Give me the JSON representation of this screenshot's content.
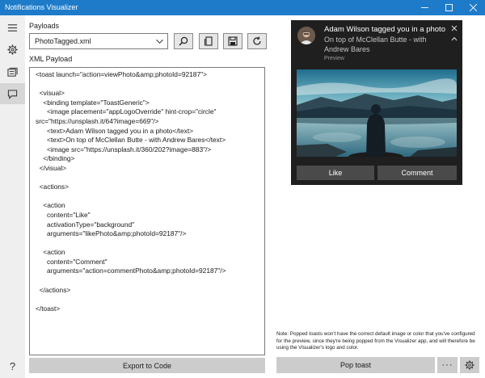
{
  "window": {
    "title": "Notifications Visualizer"
  },
  "sidebar": {
    "items": [
      {
        "name": "hamburger-menu",
        "icon": "hamburger-icon"
      },
      {
        "name": "settings",
        "icon": "gear-icon"
      },
      {
        "name": "gallery",
        "icon": "gallery-icon"
      },
      {
        "name": "notifications",
        "icon": "chat-bubble-icon",
        "active": true
      },
      {
        "name": "help",
        "icon": "question-icon",
        "help_glyph": "?"
      }
    ]
  },
  "payloads": {
    "label": "Payloads",
    "selected": "PhotoTagged.xml"
  },
  "xml": {
    "label": "XML Payload",
    "lines": [
      "<toast launch=\"action=viewPhoto&amp;photoId=92187\">",
      "",
      "  <visual>",
      "    <binding template=\"ToastGeneric\">",
      "      <image placement=\"appLogoOverride\" hint-crop=\"circle\"",
      "src=\"https://unsplash.it/64?image=669\"/>",
      "      <text>Adam Wilson tagged you in a photo</text>",
      "      <text>On top of McClellan Butte - with Andrew Bares</text>",
      "      <image src=\"https://unsplash.it/360/202?image=883\"/>",
      "    </binding>",
      "  </visual>",
      "",
      "  <actions>",
      "",
      "    <action",
      "      content=\"Like\"",
      "      activationType=\"background\"",
      "      arguments=\"likePhoto&amp;photoId=92187\"/>",
      "",
      "    <action",
      "      content=\"Comment\"",
      "      arguments=\"action=commentPhoto&amp;photoId=92187\"/>",
      "",
      "  </actions>",
      "",
      "</toast>"
    ]
  },
  "buttons": {
    "export": "Export to Code",
    "pop": "Pop toast",
    "more": "···"
  },
  "toast": {
    "title": "Adam Wilson tagged you in a photo",
    "body_line1": "On top of McClellan Butte - with",
    "body_line2": "Andrew Bares",
    "preview_label": "Preview",
    "actions": [
      "Like",
      "Comment"
    ]
  },
  "note": "Note: Popped toasts won't have the correct default image or color that you've configured for the preview, since they're being popped from the Visualizer app, and will therefore be using the Visualizer's logo and color.",
  "colors": {
    "titlebar": "#1e7bc9",
    "toast_bg": "#1f1f1f",
    "toast_button": "#4a4a4a",
    "button_gray": "#cccccc"
  }
}
